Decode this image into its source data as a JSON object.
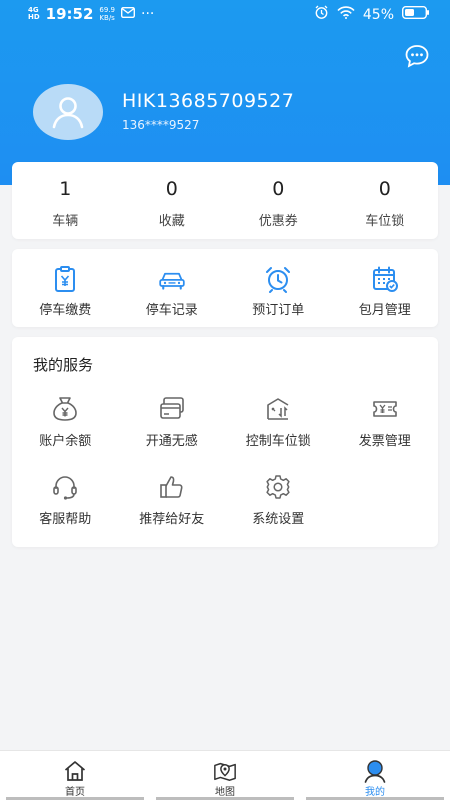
{
  "status_bar": {
    "network": "4G",
    "network_sub": "HD",
    "time": "19:52",
    "speed_value": "69.9",
    "speed_unit": "KB/s",
    "more": "···",
    "battery": "45%"
  },
  "profile": {
    "username": "HIK13685709527",
    "phone": "136****9527"
  },
  "stats": [
    {
      "value": "1",
      "label": "车辆"
    },
    {
      "value": "0",
      "label": "收藏"
    },
    {
      "value": "0",
      "label": "优惠券"
    },
    {
      "value": "0",
      "label": "车位锁"
    }
  ],
  "parking": [
    {
      "label": "停车缴费",
      "icon": "parking-payment-icon"
    },
    {
      "label": "停车记录",
      "icon": "car-icon"
    },
    {
      "label": "预订订单",
      "icon": "alarm-clock-icon"
    },
    {
      "label": "包月管理",
      "icon": "calendar-check-icon"
    }
  ],
  "services": {
    "title": "我的服务",
    "items": [
      {
        "label": "账户余额",
        "icon": "money-bag-icon"
      },
      {
        "label": "开通无感",
        "icon": "card-icon"
      },
      {
        "label": "控制车位锁",
        "icon": "parking-lock-icon"
      },
      {
        "label": "发票管理",
        "icon": "invoice-icon"
      },
      {
        "label": "客服帮助",
        "icon": "headset-icon"
      },
      {
        "label": "推荐给好友",
        "icon": "thumbs-up-icon"
      },
      {
        "label": "系统设置",
        "icon": "gear-icon"
      }
    ]
  },
  "tabbar": {
    "home": "首页",
    "map": "地图",
    "mine": "我的"
  },
  "colors": {
    "header_blue": "#1e8ef2",
    "accent_icon": "#2c8ef0",
    "active_tab": "#2c8ef0"
  }
}
